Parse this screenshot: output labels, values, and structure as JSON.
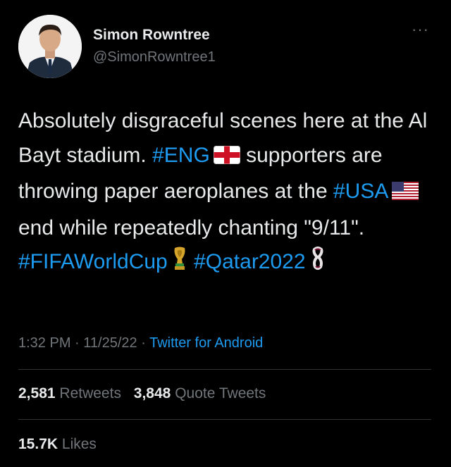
{
  "author": {
    "name": "Simon Rowntree",
    "handle": "@SimonRowntree1"
  },
  "more_menu": "···",
  "tweet": {
    "parts": [
      "Absolutely disgraceful scenes here at the Al Bayt stadium. ",
      "#ENG",
      " supporters are throwing paper aeroplanes at the ",
      "#USA",
      " end while repeatedly chanting \"9/11\". ",
      "#FIFAWorldCup",
      " ",
      "#Qatar2022"
    ]
  },
  "meta": {
    "time": "1:32 PM",
    "date": "11/25/22",
    "separator": "·",
    "source": "Twitter for Android"
  },
  "stats": {
    "retweets_count": "2,581",
    "retweets_label": "Retweets",
    "quotes_count": "3,848",
    "quotes_label": "Quote Tweets",
    "likes_count": "15.7K",
    "likes_label": "Likes"
  },
  "icons": {
    "eng_flag": "england-flag-icon",
    "usa_flag": "usa-flag-icon",
    "trophy": "trophy-icon",
    "mascot": "world-cup-emblem-icon"
  },
  "colors": {
    "background": "#000000",
    "text": "#e7e9ea",
    "secondary": "#71767b",
    "link": "#1d9bf0"
  }
}
